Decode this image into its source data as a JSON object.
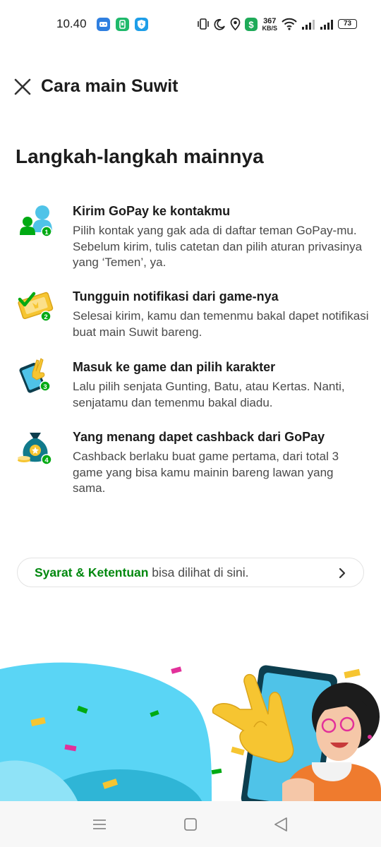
{
  "status_bar": {
    "time": "10.40",
    "network_speed_value": "367",
    "network_speed_unit": "KB/S",
    "battery_level": "73",
    "app_icons": [
      "bluetooth-app-icon",
      "phone-app-icon",
      "shield-app-icon"
    ],
    "system_icons": [
      "vibrate-icon",
      "do-not-disturb-icon",
      "location-icon",
      "money-app-icon",
      "wifi-icon",
      "signal-icon",
      "signal-icon-2",
      "battery-icon"
    ]
  },
  "header": {
    "title": "Cara main Suwit"
  },
  "section_title": "Langkah-langkah mainnya",
  "steps": [
    {
      "title": "Kirim GoPay ke kontakmu",
      "description": "Pilih kontak yang gak ada di daftar teman GoPay-mu. Sebelum kirim, tulis catetan dan pilih aturan privasinya yang ‘Temen’, ya.",
      "number": "1",
      "icon": "contacts-icon"
    },
    {
      "title": "Tungguin notifikasi dari game-nya",
      "description": "Selesai kirim, kamu dan temenmu bakal dapet notifikasi buat main Suwit bareng.",
      "number": "2",
      "icon": "ticket-icon"
    },
    {
      "title": "Masuk ke game dan pilih karakter",
      "description": "Lalu pilih senjata Gunting, Batu, atau Kertas. Nanti, senjatamu dan temenmu bakal diadu.",
      "number": "3",
      "icon": "phone-hand-icon"
    },
    {
      "title": "Yang menang dapet cashback dari GoPay",
      "description": "Cashback berlaku buat game pertama, dari total 3 game yang bisa kamu mainin bareng lawan yang sama.",
      "number": "4",
      "icon": "money-bag-icon"
    }
  ],
  "terms": {
    "link_text": "Syarat & Ketentuan",
    "rest_text": " bisa dilihat di sini."
  },
  "colors": {
    "brand_green": "#00880e",
    "badge_green": "#00aa13",
    "illustration_blue": "#5ad5f5",
    "nav_bar": "#f7f7f7"
  }
}
